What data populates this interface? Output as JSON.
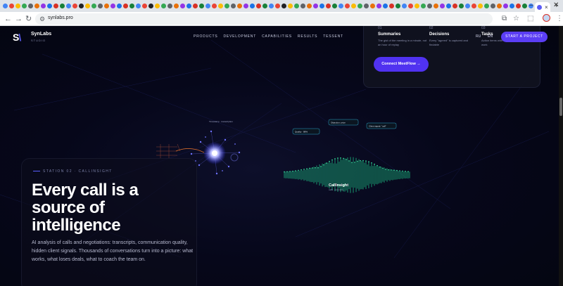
{
  "browser": {
    "url": "synlabs.pro",
    "tab_close": "×",
    "new_tab": "+",
    "window_minimize": "–",
    "window_close": "✕",
    "tab_favicon_colors": [
      "#4285f4",
      "#ea4335",
      "#fbbc05",
      "#34a853",
      "#5f6368",
      "#e8710a",
      "#9334e6",
      "#1a73e8",
      "#d93025",
      "#188038",
      "#4285f4",
      "#ea4335",
      "#202124",
      "#fbbc05",
      "#34a853",
      "#5f6368",
      "#e8710a",
      "#9334e6",
      "#1a73e8",
      "#d93025",
      "#188038",
      "#4285f4",
      "#ea4335",
      "#202124",
      "#fbbc05",
      "#34a853",
      "#5f6368",
      "#e8710a",
      "#9334e6",
      "#1a73e8",
      "#d93025",
      "#188038",
      "#4285f4",
      "#ea4335",
      "#fbbc05",
      "#34a853",
      "#5f6368",
      "#e8710a",
      "#9334e6",
      "#1a73e8",
      "#d93025",
      "#188038",
      "#4285f4",
      "#ea4335",
      "#202124",
      "#fbbc05",
      "#34a853",
      "#5f6368",
      "#e8710a",
      "#9334e6",
      "#1a73e8",
      "#d93025",
      "#188038",
      "#4285f4",
      "#ea4335",
      "#fbbc05",
      "#34a853",
      "#5f6368",
      "#e8710a",
      "#9334e6",
      "#1a73e8",
      "#d93025",
      "#188038",
      "#4285f4",
      "#ea4335",
      "#fbbc05",
      "#34a853",
      "#5f6368",
      "#e8710a",
      "#9334e6",
      "#1a73e8",
      "#d93025",
      "#188038",
      "#4285f4",
      "#ea4335",
      "#fbbc05",
      "#34a853",
      "#5f6368",
      "#e8710a",
      "#9334e6",
      "#1a73e8",
      "#d93025",
      "#188038",
      "#4285f4"
    ]
  },
  "site": {
    "logo_mark": "S",
    "logo_mark_accent": "\\",
    "name": "SynLabs",
    "sub": "STUDIO",
    "nav": [
      "PRODUCTS",
      "DEVELOPMENT",
      "CAPABILITIES",
      "RESULTS",
      "TESSENT"
    ],
    "lang": [
      "RU",
      "EN"
    ],
    "cta": "START A PROJECT",
    "accent_color": "#5b3ef5"
  },
  "feature_card": {
    "items": [
      {
        "num": "01",
        "title": "Summaries",
        "desc": "The gist of the meeting in a minute, not an hour of replay"
      },
      {
        "num": "02",
        "title": "Decisions",
        "desc": "Every \"agreed\" is captured and findable"
      },
      {
        "num": "03",
        "title": "Tasks",
        "desc": "Action items with owners straight to work"
      }
    ],
    "button": "Connect MeetFlow →"
  },
  "viz": {
    "labels": [
      "Timestamp · transcription",
      "Quality · 88%",
      "Objection: price",
      "Client signal: \"call\"",
      "CallInsight",
      "calls · inventory"
    ]
  },
  "hero": {
    "station": "STATION 02 · CALLINSIGHT",
    "title": "Every call is a source of intelligence",
    "description": "AI analysis of calls and negotiations: transcripts, communication quality, hidden client signals. Thousands of conversations turn into a picture: what works, what loses deals, what to coach the team on."
  }
}
